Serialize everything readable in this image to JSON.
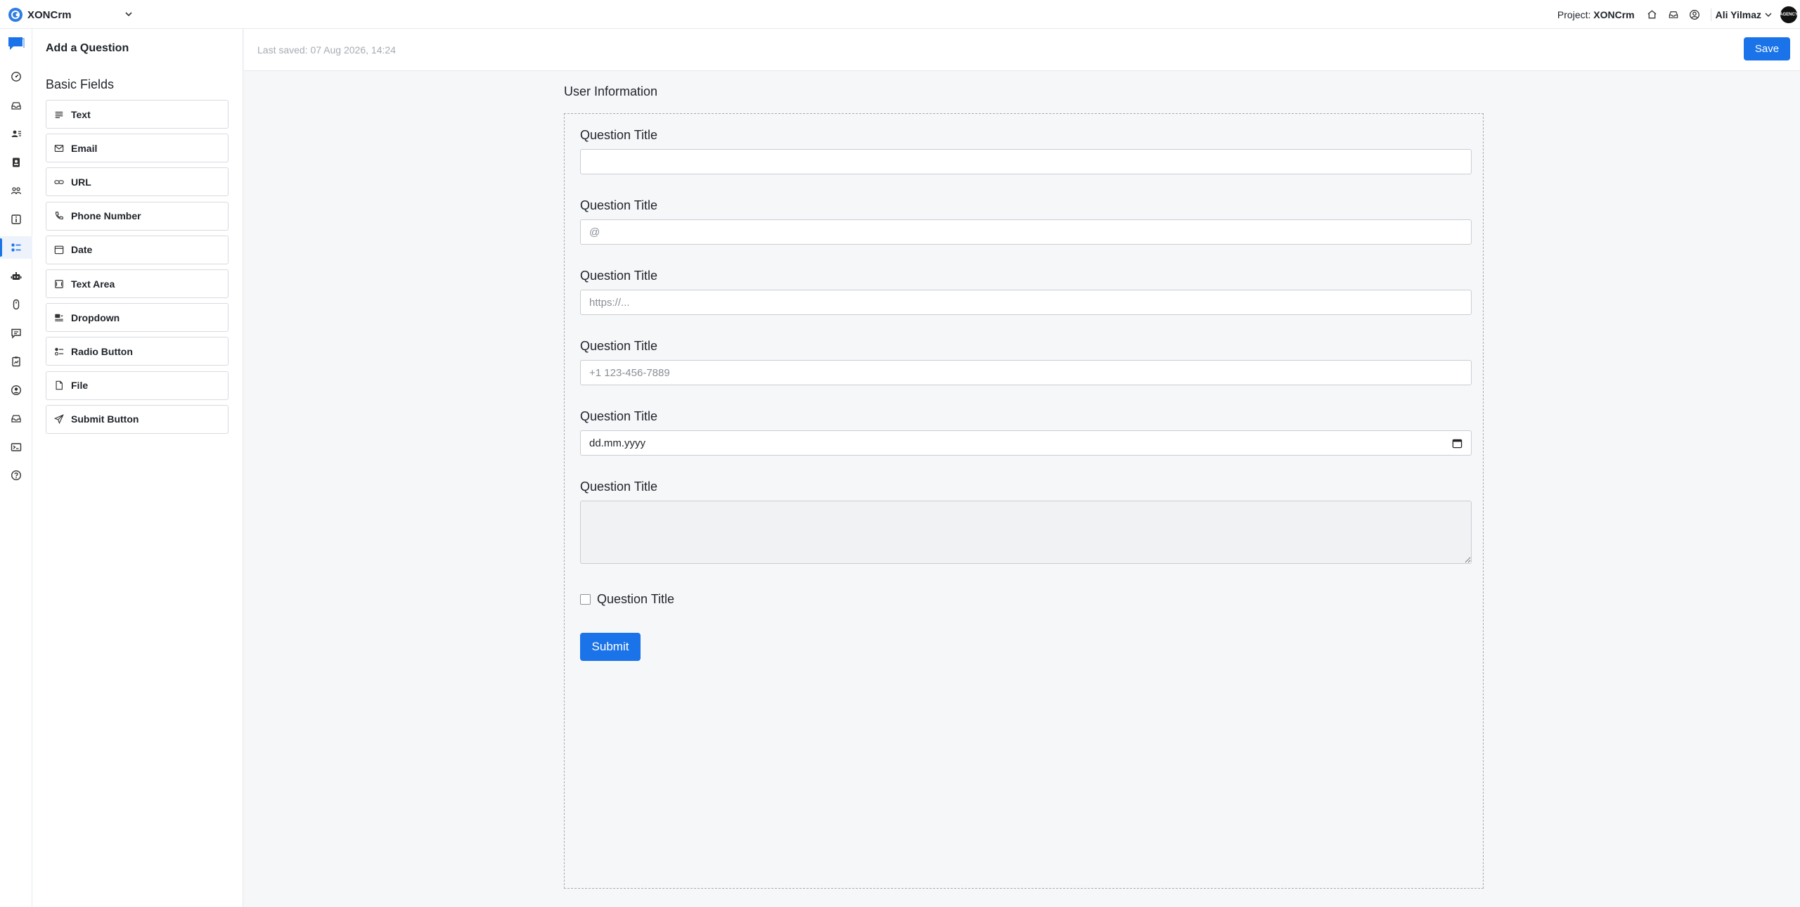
{
  "app": {
    "name": "XONCrm",
    "project_label": "Project:",
    "project_name": "XONCrm",
    "user_name": "Ali Yilmaz",
    "avatar_text": "AGENCY"
  },
  "colors": {
    "accent": "#1a73e8",
    "border": "#d7dadf",
    "muted": "#a6abb3"
  },
  "rail": {
    "icons": [
      "chat-icon",
      "dashboard-icon",
      "inbox-icon",
      "contacts-icon",
      "contact-card-icon",
      "teams-icon",
      "info-icon",
      "forms-icon",
      "bot-icon",
      "mouse-icon",
      "messages-icon",
      "reports-icon",
      "profile-icon",
      "inbox-tray-icon",
      "terminal-icon",
      "help-icon"
    ],
    "active_index": 7
  },
  "panel": {
    "title": "Add a Question",
    "section": "Basic Fields",
    "fields": [
      {
        "label": "Text",
        "icon": "text-lines-icon"
      },
      {
        "label": "Email",
        "icon": "mail-icon"
      },
      {
        "label": "URL",
        "icon": "link-icon"
      },
      {
        "label": "Phone Number",
        "icon": "phone-icon"
      },
      {
        "label": "Date",
        "icon": "calendar-icon"
      },
      {
        "label": "Text Area",
        "icon": "text-area-icon"
      },
      {
        "label": "Dropdown",
        "icon": "dropdown-icon"
      },
      {
        "label": "Radio Button",
        "icon": "radio-icon"
      },
      {
        "label": "File",
        "icon": "file-icon"
      },
      {
        "label": "Submit Button",
        "icon": "send-icon"
      }
    ]
  },
  "header": {
    "last_saved": "Last saved: 07 Aug 2026, 14:24",
    "save_label": "Save"
  },
  "form": {
    "section_title": "User Information",
    "questions": [
      {
        "label": "Question Title",
        "placeholder": ""
      },
      {
        "label": "Question Title",
        "placeholder": "@"
      },
      {
        "label": "Question Title",
        "placeholder": "https://..."
      },
      {
        "label": "Question Title",
        "placeholder": "+1 123-456-7889"
      },
      {
        "label": "Question Title",
        "date_value": "dd.mm.yyyy"
      },
      {
        "label": "Question Title"
      }
    ],
    "checkbox_label": "Question Title",
    "submit_label": "Submit"
  }
}
